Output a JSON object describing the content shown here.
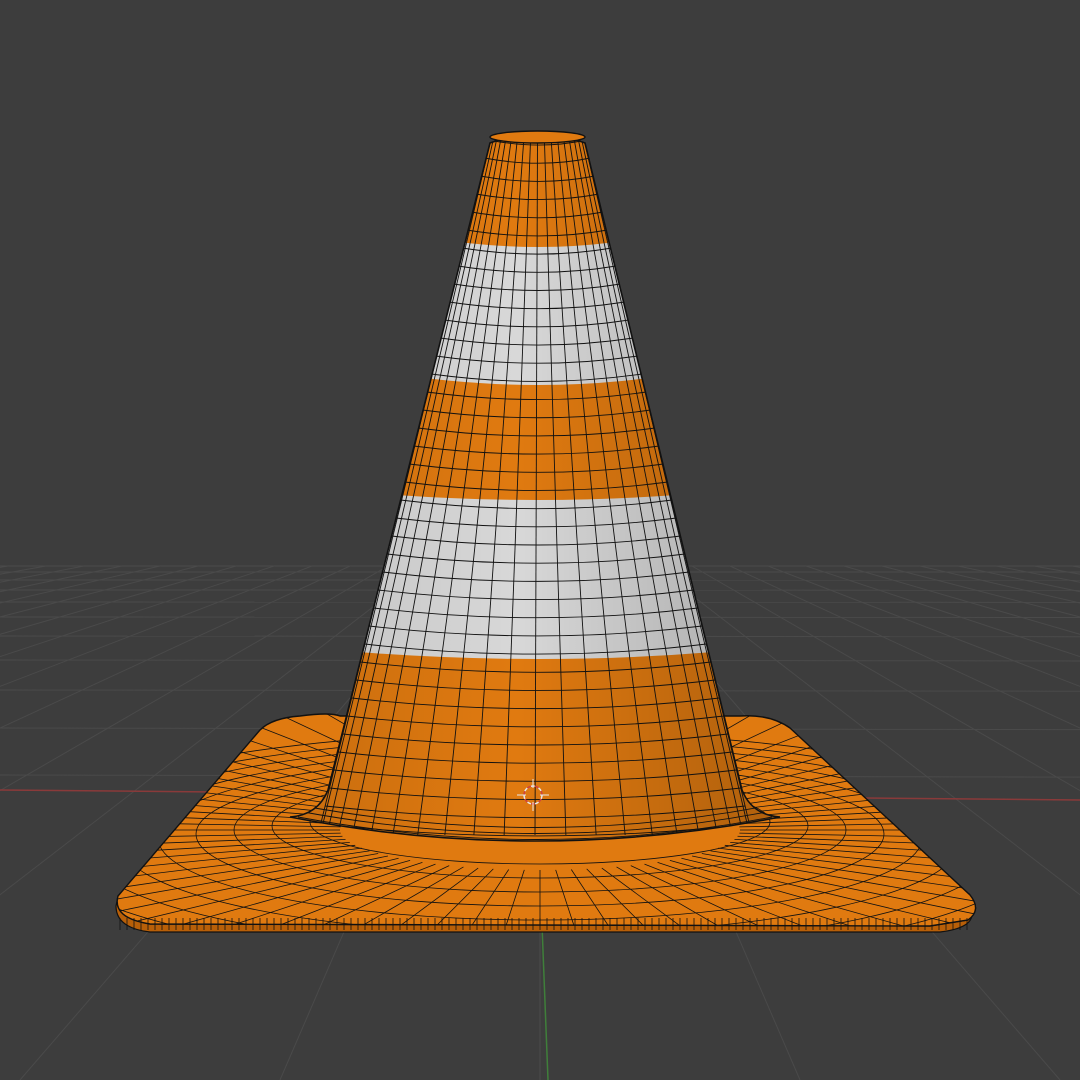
{
  "viewport": {
    "background_color": "#3d3d3d",
    "grid_color": "#4a4a4a",
    "x_axis_color": "#8a3a3a",
    "y_axis_color": "#3f7f3a"
  },
  "object": {
    "kind": "traffic-cone",
    "primary_color": "#e07a10",
    "stripe_color": "#d8d8d8",
    "wire_color": "#111111",
    "shading": "solid-with-wireframe-overlay"
  },
  "cursor": {
    "icon": "3d-cursor-icon",
    "ring_color_a": "#e8e8e8",
    "ring_color_b": "#d04040"
  }
}
